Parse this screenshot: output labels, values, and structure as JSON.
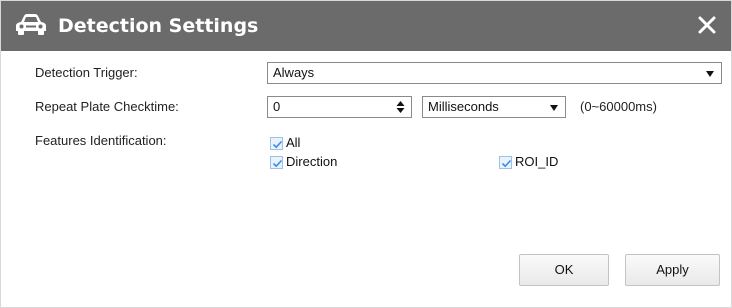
{
  "dialog": {
    "title": "Detection Settings",
    "title_icon": "car-icon",
    "close_icon": "close-icon"
  },
  "detection_trigger": {
    "label": "Detection Trigger:",
    "value": "Always"
  },
  "repeat_plate_checktime": {
    "label": "Repeat Plate Checktime:",
    "value": "0",
    "unit": "Milliseconds",
    "range_note": "(0~60000ms)"
  },
  "features_identification": {
    "label": "Features Identification:",
    "options": [
      {
        "label": "All",
        "checked": true
      },
      {
        "label": "Direction",
        "checked": true
      },
      {
        "label": "ROI_ID",
        "checked": true
      }
    ]
  },
  "buttons": {
    "ok": "OK",
    "apply": "Apply"
  },
  "colors": {
    "titlebar": "#6b6b6b",
    "checkmark": "#3a8ee6"
  }
}
